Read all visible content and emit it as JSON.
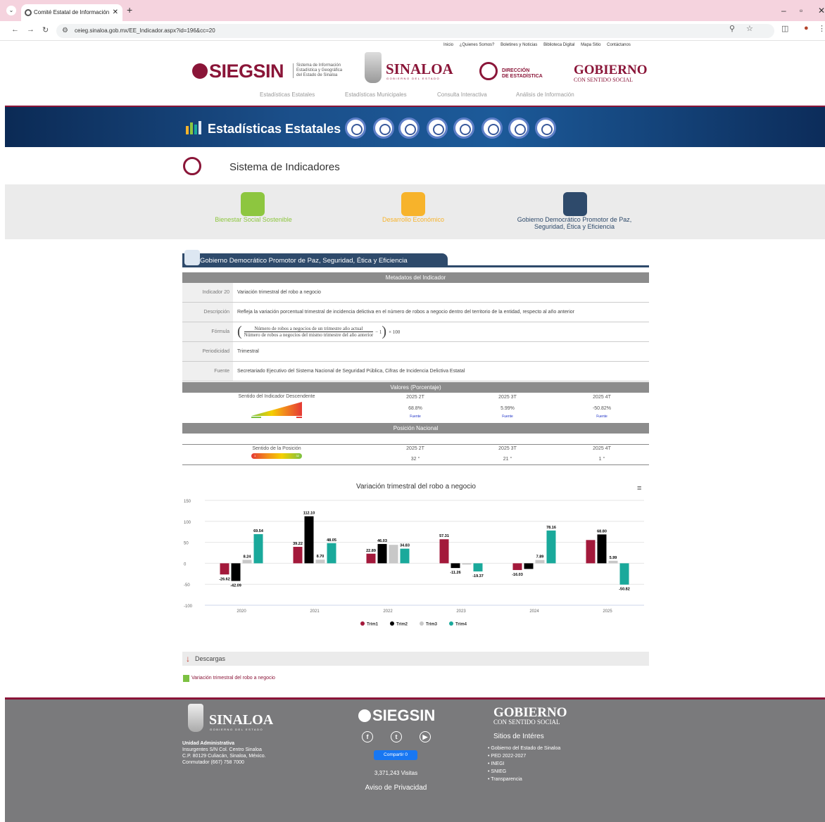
{
  "browser": {
    "tab_title": "Comité Estatal de Información",
    "url": "ceieg.sinaloa.gob.mx/EE_Indicador.aspx?id=196&cc=20"
  },
  "header": {
    "top_menu": [
      "Inicio",
      "¿Quienes Somos?",
      "Boletines y Noticias",
      "Biblioteca Digital",
      "Mapa Sitio",
      "Contáctanos"
    ],
    "siegsin": "SIEGSIN",
    "siegsin_sub": [
      "Sistema de Información",
      "Estadística y Geográfica",
      "del Estado de Sinaloa"
    ],
    "sinaloa": "SINALOA",
    "sinaloa_sub": "GOBIERNO DEL ESTADO",
    "direccion": [
      "DIRECCIÓN",
      "DE ESTADÍSTICA"
    ],
    "gobierno": "GOBIERNO",
    "gobierno_sub": "CON SENTIDO SOCIAL",
    "nav": [
      "Estadísticas Estatales",
      "Estadísticas Municipales",
      "Consulta Interactiva",
      "Análisis de Información"
    ]
  },
  "banner": {
    "title": "Estadísticas Estatales"
  },
  "sistema": {
    "title": "Sistema de Indicadores"
  },
  "axes": [
    {
      "label": "Bienestar Social Sostenible",
      "color": "#8dc63f"
    },
    {
      "label": "Desarrollo Económico",
      "color": "#f7b32b"
    },
    {
      "label": "Gobierno Democrático Promotor de Paz,",
      "label2": "Seguridad, Ética y Eficiencia",
      "color": "#2e4a6b"
    }
  ],
  "section": {
    "title": "Gobierno Democrático Promotor de Paz, Seguridad, Ética y Eficiencia"
  },
  "metadata": {
    "header": "Metadatos del Indicador",
    "rows": [
      {
        "key": "Indicador 20",
        "value": "Variación trimestral del robo a negocio"
      },
      {
        "key": "Descripción",
        "value": "Refleja la variación porcentual trimestral de incidencia delictiva en el número de robos a negocio dentro del territorio de la entidad, respecto al año anterior"
      },
      {
        "key": "Fórmula",
        "numerator": "Número de robos a negocios de un trimestre año actual",
        "denominator": "Número de robos a negocios del mismo trimestre del año anterior",
        "tail": "− 1",
        "mult": "× 100"
      },
      {
        "key": "Periodicidad",
        "value": "Trimestral"
      },
      {
        "key": "Fuente",
        "value": "Secretariado Ejecutivo del Sistema Nacional de Seguridad Pública, Cifras de Incidencia Delictiva Estatal"
      }
    ]
  },
  "valores": {
    "header": "Valores (Porcentaje)",
    "sentido": "Sentido del Indicador Descendente",
    "cols": [
      {
        "period": "2025 2T",
        "value": "68.8%",
        "link": "Fuente"
      },
      {
        "period": "2025 3T",
        "value": "5.99%",
        "link": "Fuente"
      },
      {
        "period": "2025 4T",
        "value": "-50.82%",
        "link": "Fuente"
      }
    ]
  },
  "posicion": {
    "header": "Posición Nacional",
    "sentido": "Sentido de la Posición",
    "bar_left": "1",
    "bar_right": "32",
    "cols": [
      {
        "period": "2025 2T",
        "value": "32 °"
      },
      {
        "period": "2025 3T",
        "value": "21 °"
      },
      {
        "period": "2025 4T",
        "value": "1 °"
      }
    ]
  },
  "chart_data": {
    "type": "bar",
    "title": "Variación trimestral del robo a negocio",
    "categories": [
      "2020",
      "2021",
      "2022",
      "2023",
      "2024",
      "2025"
    ],
    "ylim": [
      -100,
      150
    ],
    "yticks": [
      150,
      100,
      50,
      0,
      -50,
      -100
    ],
    "legend_position": "bottom",
    "series": [
      {
        "name": "Trim1",
        "color": "#a3193b",
        "values": [
          -26.62,
          39.22,
          22.89,
          57.31,
          -16.03,
          55.5
        ]
      },
      {
        "name": "Trim2",
        "color": "#000000",
        "values": [
          -42.09,
          112.1,
          46.03,
          -11.26,
          -13.5,
          68.8
        ]
      },
      {
        "name": "Trim3",
        "color": "#c8c8c8",
        "values": [
          8.24,
          8.7,
          44.0,
          -3.0,
          7.89,
          5.99
        ]
      },
      {
        "name": "Trim4",
        "color": "#1aa99b",
        "values": [
          69.54,
          48.05,
          34.83,
          -19.37,
          78.16,
          -50.82
        ]
      }
    ],
    "data_labels": [
      {
        "series": 0,
        "category": 0,
        "text": "-26.62"
      },
      {
        "series": 1,
        "category": 0,
        "text": "-42.09"
      },
      {
        "series": 2,
        "category": 0,
        "text": "8.24"
      },
      {
        "series": 3,
        "category": 0,
        "text": "69.54"
      },
      {
        "series": 0,
        "category": 1,
        "text": "39.22"
      },
      {
        "series": 1,
        "category": 1,
        "text": "112.10"
      },
      {
        "series": 2,
        "category": 1,
        "text": "8.70"
      },
      {
        "series": 3,
        "category": 1,
        "text": "48.05"
      },
      {
        "series": 0,
        "category": 2,
        "text": "22.89"
      },
      {
        "series": 1,
        "category": 2,
        "text": "46.03"
      },
      {
        "series": 3,
        "category": 2,
        "text": "34.83"
      },
      {
        "series": 0,
        "category": 3,
        "text": "57.31"
      },
      {
        "series": 1,
        "category": 3,
        "text": "-11.26"
      },
      {
        "series": 3,
        "category": 3,
        "text": "-19.37"
      },
      {
        "series": 0,
        "category": 4,
        "text": "-16.03"
      },
      {
        "series": 2,
        "category": 4,
        "text": "7.89"
      },
      {
        "series": 3,
        "category": 4,
        "text": "78.16"
      },
      {
        "series": 1,
        "category": 5,
        "text": "68.80"
      },
      {
        "series": 2,
        "category": 5,
        "text": "5.99"
      },
      {
        "series": 3,
        "category": 5,
        "text": "-50.82"
      }
    ]
  },
  "descargas": {
    "title": "Descargas",
    "link": "Variación trimestral del robo a negocio"
  },
  "footer": {
    "sinaloa": "SINALOA",
    "sinaloa_sub": "GOBIERNO DEL ESTADO",
    "address": [
      "Unidad Administrativa",
      "Insurgentes S/N Col. Centro Sinaloa",
      "C.P. 80129 Culiacán, Sinaloa, México.",
      "Conmutador (667) 758 7000"
    ],
    "siegsin": "SIEGSIN",
    "share": "Compartir 0",
    "visits": "3,371,243 Visitas",
    "aviso": "Aviso de Privacidad",
    "gobierno": "GOBIERNO",
    "gobierno_sub": "CON SENTIDO SOCIAL",
    "sitios_title": "Sitios de Intéres",
    "sitios": [
      "Gobierno del Estado de Sinaloa",
      "PED 2022-2027",
      "INEGI",
      "SNIEG",
      "Transparencia"
    ]
  }
}
